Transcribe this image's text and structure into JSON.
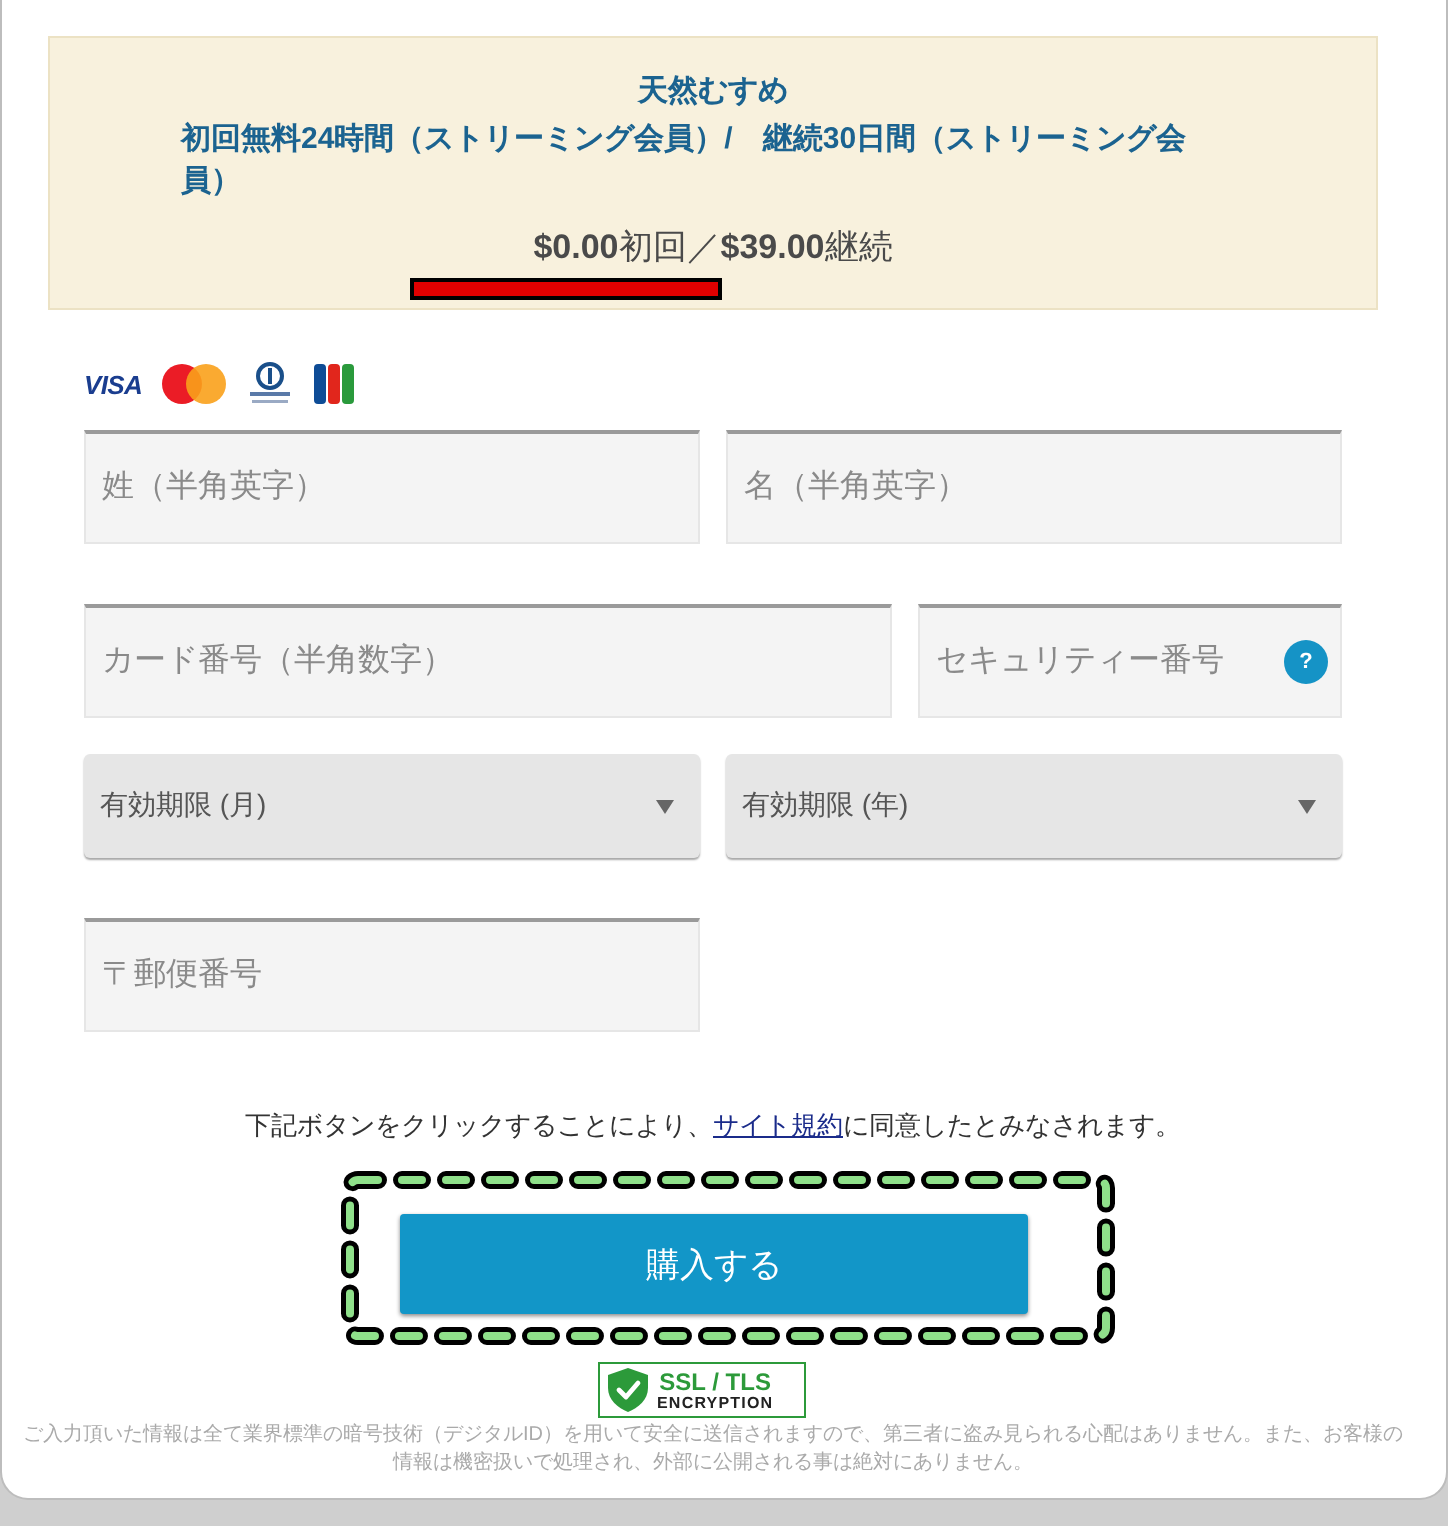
{
  "plan": {
    "title": "天然むすめ",
    "description": "初回無料24時間（ストリーミング会員）/　継続30日間（ストリーミング会員）",
    "price": "**$0.00**初回／**$39.00**継続"
  },
  "card_brands": [
    {
      "kind": "visa",
      "text": "VISA"
    },
    {
      "kind": "mastercard"
    },
    {
      "kind": "diners"
    },
    {
      "kind": "jcb"
    }
  ],
  "form_rows": [
    {
      "fields": [
        {
          "kind": "text",
          "placeholder": "姓（半角英字）"
        },
        {
          "kind": "text",
          "placeholder": "名（半角英字）"
        }
      ]
    },
    {
      "fields": [
        {
          "kind": "text",
          "placeholder": "カード番号（半角数字）"
        },
        {
          "kind": "help",
          "placeholder": "セキュリティー番号",
          "help": "?"
        }
      ]
    },
    {
      "fields": [
        {
          "kind": "select",
          "label": "有効期限 (月)"
        },
        {
          "kind": "select",
          "label": "有効期限 (年)"
        }
      ]
    },
    {
      "fields": [
        {
          "kind": "text",
          "placeholder": "〒郵便番号"
        }
      ]
    }
  ],
  "agreement": {
    "before": "下記ボタンをクリックすることにより、",
    "link": "サイト規約",
    "after": "に同意したとみなされます。"
  },
  "submit_button": "購入する",
  "ssl_badge": {
    "title": "SSL / TLS",
    "subtitle": "ENCRYPTION"
  },
  "footer_note": "ご入力頂いた情報は全て業界標準の暗号技術（デジタルID）を用いて安全に送信されますので、第三者に盗み見られる心配はありません。また、お客様の情報は機密扱いで処理され、外部に公開される事は絶対にありません。"
}
